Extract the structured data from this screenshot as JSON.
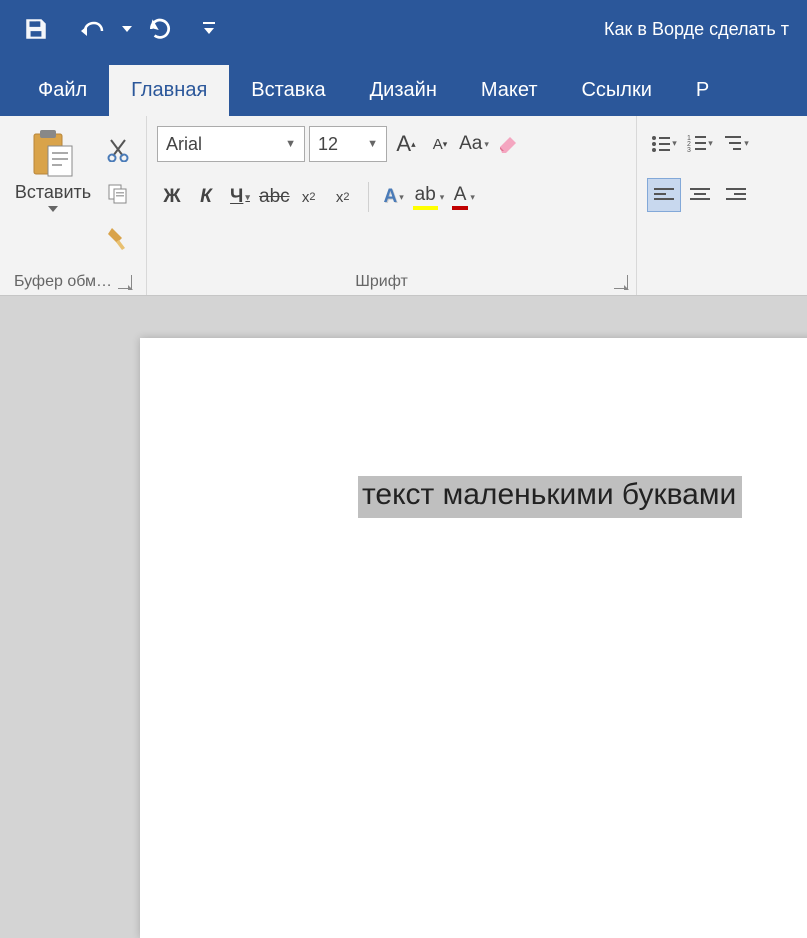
{
  "titlebar": {
    "document_title": "Как в Ворде сделать т"
  },
  "tabs": {
    "file": "Файл",
    "home": "Главная",
    "insert": "Вставка",
    "design": "Дизайн",
    "layout": "Макет",
    "references": "Ссылки",
    "partial": "Р"
  },
  "ribbon": {
    "clipboard": {
      "label": "Буфер обм…",
      "paste": "Вставить"
    },
    "font": {
      "label": "Шрифт",
      "family": "Arial",
      "size": "12",
      "bold": "Ж",
      "italic": "К",
      "underline": "Ч",
      "strike": "abc",
      "sub": "x",
      "sup": "x",
      "grow": "A",
      "shrink": "A",
      "case": "Aa",
      "textfx": "A",
      "highlight": "ab",
      "fontcolor": "A"
    },
    "paragraph": {
      "label": ""
    }
  },
  "document": {
    "selected_text": "текст маленькими буквами"
  }
}
